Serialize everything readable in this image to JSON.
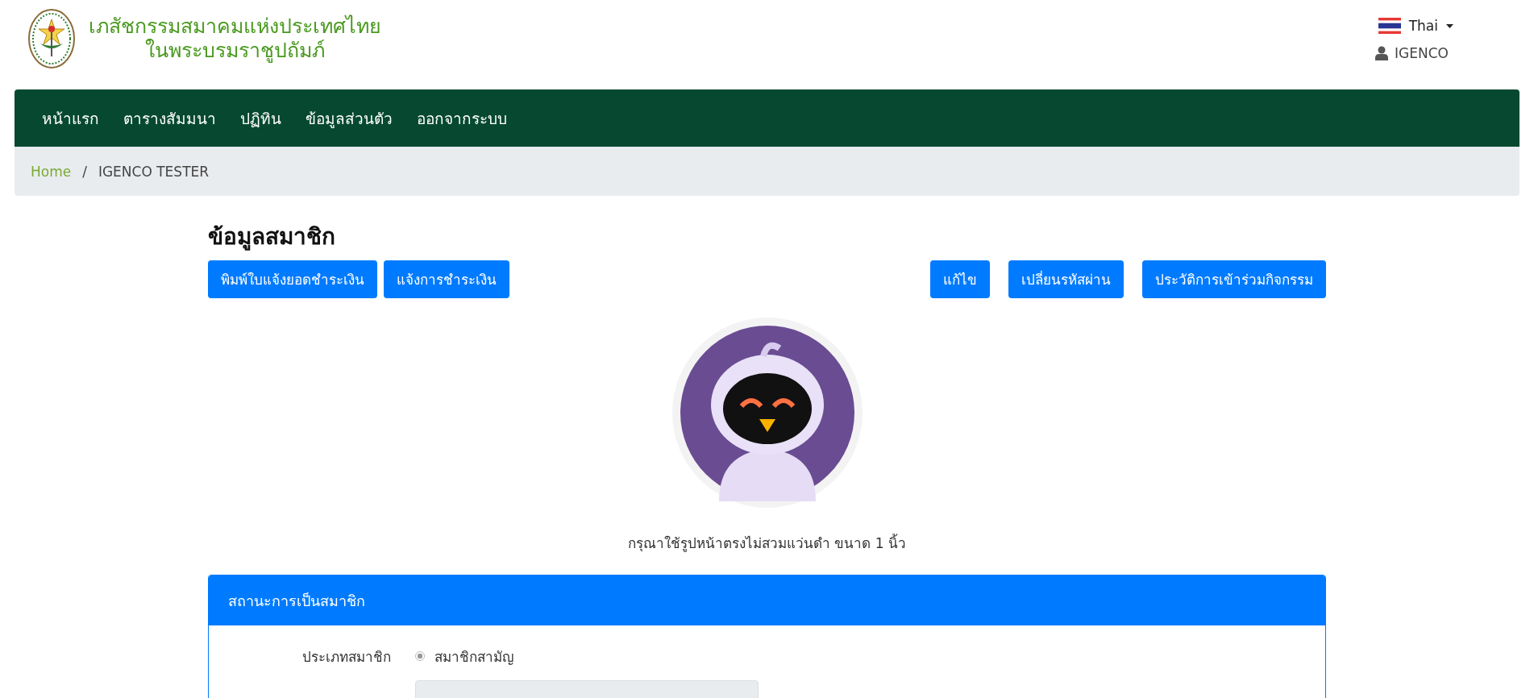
{
  "header": {
    "title_line_1": "เภสัชกรรมสมาคมแห่งประเทศไทย",
    "title_line_2": "ในพระบรมราชูปถัมภ์",
    "language": "Thai",
    "user": "IGENCO"
  },
  "nav": [
    {
      "label": "หน้าแรก"
    },
    {
      "label": "ตารางสัมมนา"
    },
    {
      "label": "ปฏิทิน"
    },
    {
      "label": "ข้อมูลส่วนตัว"
    },
    {
      "label": "ออกจากระบบ"
    }
  ],
  "breadcrumb": [
    {
      "label": "Home",
      "kind": "link"
    },
    {
      "label": "/",
      "kind": "separator"
    },
    {
      "label": "IGENCO TESTER",
      "kind": "current"
    }
  ],
  "page_title": "ข้อมูลสมาชิก",
  "actions_left": [
    "พิมพ์ใบแจ้งยอดชำระเงิน",
    "แจ้งการชำระเงิน"
  ],
  "actions_right": [
    "แก้ไข",
    "เปลี่ยนรหัสผ่าน",
    "ประวัติการเข้าร่วมกิจกรรม"
  ],
  "photo_hint": "กรุณาใช้รูปหน้าตรงไม่สวมแว่นดำ ขนาด 1 นิ้ว",
  "card": {
    "title": "สถานะการเป็นสมาชิก",
    "rows": [
      {
        "kind": "radio",
        "label": "ประเภทสมาชิก",
        "option": "สมาชิกสามัญ",
        "selected": true
      },
      {
        "kind": "field"
      }
    ]
  }
}
